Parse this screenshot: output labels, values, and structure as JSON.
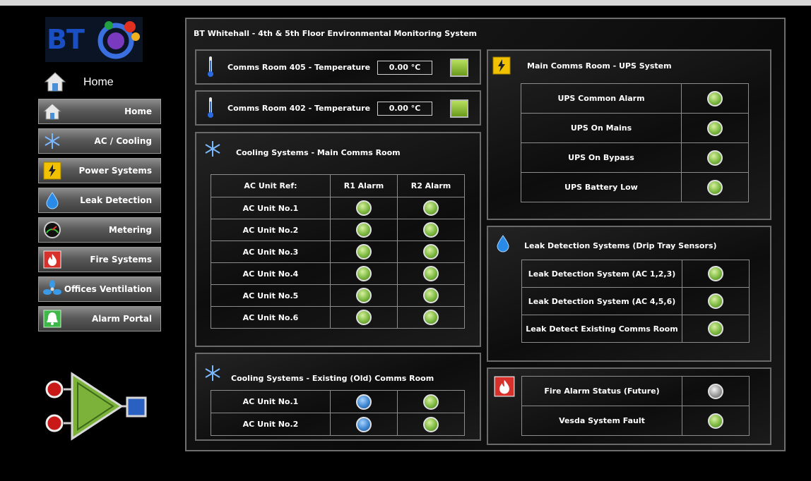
{
  "logo": {
    "text": "BT"
  },
  "nav": {
    "home_heading": "Home",
    "items": [
      {
        "label": "Home",
        "icon": "home-icon"
      },
      {
        "label": "AC / Cooling",
        "icon": "snowflake-icon"
      },
      {
        "label": "Power Systems",
        "icon": "lightning-icon"
      },
      {
        "label": "Leak Detection",
        "icon": "water-drop-icon"
      },
      {
        "label": "Metering",
        "icon": "gauge-icon"
      },
      {
        "label": "Fire Systems",
        "icon": "fire-icon"
      },
      {
        "label": "Offices Ventilation",
        "icon": "fan-icon"
      },
      {
        "label": "Alarm Portal",
        "icon": "bell-icon"
      }
    ]
  },
  "title": "BT Whitehall - 4th & 5th Floor Environmental Monitoring System",
  "temps": [
    {
      "label": "Comms Room 405 - Temperature",
      "value": "0.00 °C"
    },
    {
      "label": "Comms Room 402 - Temperature",
      "value": "0.00 °C"
    }
  ],
  "cooling_main": {
    "title": "Cooling Systems - Main Comms Room",
    "headers": [
      "AC Unit Ref:",
      "R1 Alarm",
      "R2 Alarm"
    ],
    "rows": [
      {
        "label": "AC Unit No.1",
        "r1": "green",
        "r2": "green"
      },
      {
        "label": "AC Unit No.2",
        "r1": "green",
        "r2": "green"
      },
      {
        "label": "AC Unit No.3",
        "r1": "green",
        "r2": "green"
      },
      {
        "label": "AC Unit No.4",
        "r1": "green",
        "r2": "green"
      },
      {
        "label": "AC Unit No.5",
        "r1": "green",
        "r2": "green"
      },
      {
        "label": "AC Unit No.6",
        "r1": "green",
        "r2": "green"
      }
    ]
  },
  "cooling_old": {
    "title": "Cooling Systems - Existing (Old) Comms Room",
    "rows": [
      {
        "label": "AC Unit No.1",
        "r1": "blue",
        "r2": "green"
      },
      {
        "label": "AC Unit No.2",
        "r1": "blue",
        "r2": "green"
      }
    ]
  },
  "ups": {
    "title": "Main Comms Room - UPS System",
    "rows": [
      {
        "label": "UPS Common Alarm",
        "state": "green"
      },
      {
        "label": "UPS On Mains",
        "state": "green"
      },
      {
        "label": "UPS On Bypass",
        "state": "green"
      },
      {
        "label": "UPS Battery Low",
        "state": "green"
      }
    ]
  },
  "leak": {
    "title": "Leak Detection Systems (Drip Tray Sensors)",
    "rows": [
      {
        "label": "Leak Detection System (AC 1,2,3)",
        "state": "green"
      },
      {
        "label": "Leak Detection System (AC 4,5,6)",
        "state": "green"
      },
      {
        "label": "Leak Detect Existing Comms Room",
        "state": "green"
      }
    ]
  },
  "fire": {
    "rows": [
      {
        "label": "Fire Alarm Status (Future)",
        "state": "grey"
      },
      {
        "label": "Vesda System Fault",
        "state": "green"
      }
    ]
  },
  "colors": {
    "green_led": "#7cb840",
    "blue_led": "#3e86d0",
    "grey_led": "#9a9a9a",
    "panel_border": "#6a6a6a",
    "brand_blue": "#1a4fc4"
  }
}
